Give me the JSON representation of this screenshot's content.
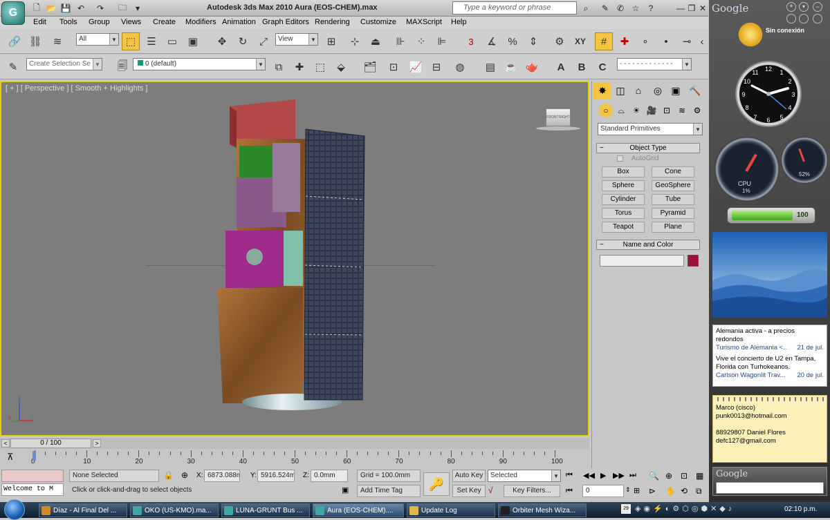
{
  "titlebar": {
    "app_title": "Autodesk 3ds Max  2010      Aura (EOS-CHEM).max",
    "search_placeholder": "Type a keyword or phrase",
    "minimize": "—",
    "restore": "❐",
    "close": "✕"
  },
  "menu": [
    "Edit",
    "Tools",
    "Group",
    "Views",
    "Create",
    "Modifiers",
    "Animation",
    "Graph Editors",
    "Rendering",
    "Customize",
    "MAXScript",
    "Help"
  ],
  "toolbar1": {
    "selection_filter": "All",
    "ref_coord": "View",
    "snap_labels": [
      "3",
      "XY"
    ]
  },
  "toolbar2": {
    "named_selection": "Create Selection Se",
    "layer": "0 (default)",
    "abc_labels": [
      "A",
      "B",
      "C"
    ]
  },
  "viewport": {
    "label": "[ + ] [ Perspective ] [ Smooth + Highlights ]",
    "viewcube_labels": [
      "FRONT",
      "RIGHT"
    ],
    "axis_labels": [
      "z",
      "x",
      "y"
    ]
  },
  "command_panel": {
    "category": "Standard Primitives",
    "object_type_title": "Object Type",
    "autogrid": "AutoGrid",
    "buttons": [
      "Box",
      "Cone",
      "Sphere",
      "GeoSphere",
      "Cylinder",
      "Tube",
      "Torus",
      "Pyramid",
      "Teapot",
      "Plane"
    ],
    "name_color_title": "Name and Color",
    "object_color": "#a0103a"
  },
  "timeline": {
    "frame_readout": "0 / 100",
    "ticks": [
      "0",
      "10",
      "20",
      "30",
      "40",
      "50",
      "60",
      "70",
      "80",
      "90",
      "100"
    ]
  },
  "status": {
    "maxscript": "Welcome to M",
    "selection": "None Selected",
    "prompt": "Click or click-and-drag to select objects",
    "x_label": "X:",
    "x_value": "6873.088m",
    "y_label": "Y:",
    "y_value": "5916.524m",
    "z_label": "Z:",
    "z_value": "0.0mm",
    "grid": "Grid = 100.0mm",
    "add_time_tag": "Add Time Tag",
    "auto_key": "Auto Key",
    "set_key": "Set Key",
    "key_mode": "Selected",
    "key_filters": "Key Filters...",
    "frame": "0"
  },
  "taskbar": {
    "tasks": [
      {
        "label": "Díaz - Al Final Del ...",
        "color": "#d08a2a"
      },
      {
        "label": "OKO (US-KMO).ma...",
        "color": "#3fa7a0"
      },
      {
        "label": "LUNA-GRUNT Bus ...",
        "color": "#3fa7a0"
      },
      {
        "label": "Aura (EOS-CHEM)....",
        "color": "#3fa7a0"
      },
      {
        "label": "Update Log",
        "color": "#e0b84a"
      },
      {
        "label": "Orbiter Mesh Wiza...",
        "color": "#222222"
      }
    ],
    "tray_day": "29",
    "clock": "02:10 p.m."
  },
  "sidebar": {
    "google_title": "Google",
    "weather_status": "Sin conexión",
    "cpu_label": "CPU",
    "cpu_value": "1%",
    "mem_value": "52%",
    "battery_value": "100",
    "news": [
      {
        "title": "Alemania activa - a precios redondos",
        "source": "Turismo de Alemania <..",
        "date": "21 de jul."
      },
      {
        "title": "Vive el concierto de U2 en Tampa, Florida con Turhokeanos.",
        "source": "Carlson Wagonlit Trav...",
        "date": "20 de jul."
      }
    ],
    "notes": [
      "Marco (cisco)",
      "punk0013@hotmail.com",
      "",
      "88929807 Daniel Flores",
      "defc127@gmail.com"
    ],
    "google_search_label": "Google"
  }
}
